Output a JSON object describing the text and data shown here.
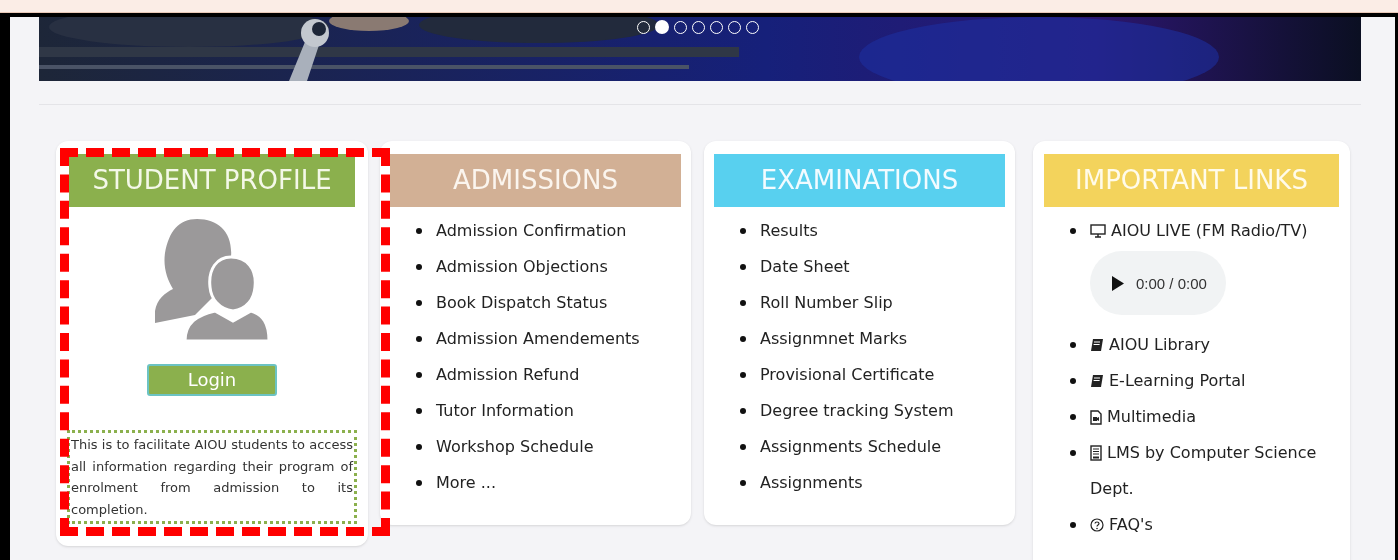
{
  "carousel": {
    "dots": [
      {
        "selected": false
      },
      {
        "selected": true
      },
      {
        "selected": false
      },
      {
        "selected": false
      },
      {
        "selected": false
      },
      {
        "selected": false
      },
      {
        "selected": false
      }
    ]
  },
  "student_profile": {
    "title": "STUDENT PROFILE",
    "button": "Login",
    "description": "This is to facilitate AIOU students to access all information regarding their program of enrolment from admission to its completion."
  },
  "admissions": {
    "title": "ADMISSIONS",
    "items": [
      "Admission Confirmation",
      "Admission Objections",
      "Book Dispatch Status",
      "Admission Amendements",
      "Admission Refund",
      "Tutor Information",
      "Workshop Schedule",
      "More ..."
    ]
  },
  "examinations": {
    "title": "EXAMINATIONS",
    "items": [
      "Results",
      "Date Sheet",
      "Roll Number Slip",
      "Assignmnet Marks",
      "Provisional Certificate",
      "Degree tracking System",
      "Assignments Schedule",
      "Assignments"
    ]
  },
  "important_links": {
    "title": "IMPORTANT LINKS",
    "items": [
      {
        "kind": "monitor",
        "label": "AIOU LIVE (FM Radio/TV)",
        "player": {
          "time": "0:00 / 0:00"
        }
      },
      {
        "kind": "book",
        "label": "AIOU Library"
      },
      {
        "kind": "book",
        "label": "E-Learning Portal"
      },
      {
        "kind": "media",
        "label": "Multimedia"
      },
      {
        "kind": "tablet",
        "label": "LMS by Computer Science Dept."
      },
      {
        "kind": "question",
        "label": "FAQ's"
      }
    ]
  }
}
